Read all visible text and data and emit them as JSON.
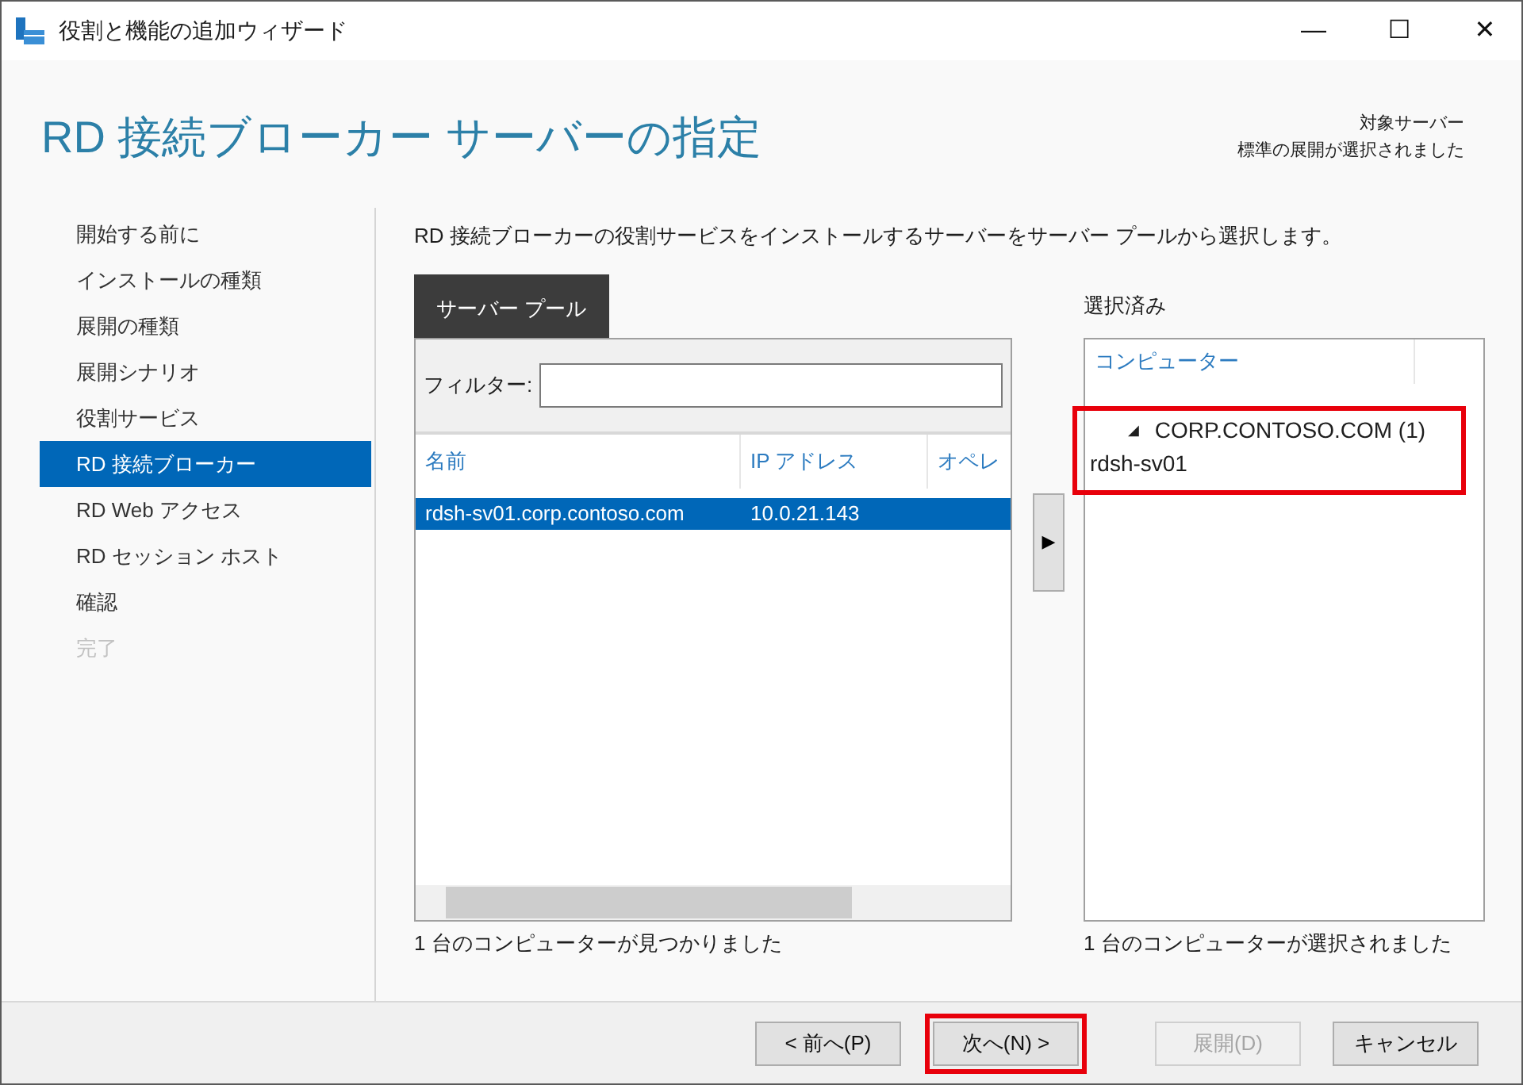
{
  "window": {
    "title": "役割と機能の追加ウィザード",
    "controls": [
      "—",
      "☐",
      "✕"
    ]
  },
  "header": {
    "title": "RD 接続ブローカー サーバーの指定",
    "target_label": "対象サーバー",
    "target_value": "標準の展開が選択されました"
  },
  "steps": [
    {
      "label": "開始する前に",
      "selected": false,
      "disabled": false
    },
    {
      "label": "インストールの種類",
      "selected": false,
      "disabled": false
    },
    {
      "label": "展開の種類",
      "selected": false,
      "disabled": false
    },
    {
      "label": "展開シナリオ",
      "selected": false,
      "disabled": false
    },
    {
      "label": "役割サービス",
      "selected": false,
      "disabled": false
    },
    {
      "label": "RD 接続ブローカー",
      "selected": true,
      "disabled": false
    },
    {
      "label": "RD Web アクセス",
      "selected": false,
      "disabled": false
    },
    {
      "label": "RD セッション ホスト",
      "selected": false,
      "disabled": false
    },
    {
      "label": "確認",
      "selected": false,
      "disabled": false
    },
    {
      "label": "完了",
      "selected": false,
      "disabled": true
    }
  ],
  "instruction": "RD 接続ブローカーの役割サービスをインストールするサーバーをサーバー プールから選択します。",
  "pool": {
    "tab": {
      "label": "サーバー プール",
      "selected": true
    },
    "filter_label": "フィルター:",
    "columns": [
      "名前",
      "IP アドレス",
      "オペレ"
    ],
    "rows": [
      {
        "cells": [
          "rdsh-sv01.corp.contoso.com",
          "10.0.21.143"
        ],
        "selected": true
      }
    ],
    "status": "1 台のコンピューターが見つかりました"
  },
  "add_button": "▶",
  "selected_list": {
    "label": "選択済み",
    "column": "コンピューター",
    "groups": [
      {
        "label": "CORP.CONTOSO.COM (1)",
        "expander": "◢",
        "expanded": true,
        "highlighted": true,
        "children": [
          {
            "label": "rdsh-sv01"
          }
        ]
      }
    ],
    "status": "1 台のコンピューターが選択されました"
  },
  "buttons": [
    {
      "label": "< 前へ(P)",
      "disabled": false,
      "highlighted": false
    },
    {
      "label": "次へ(N) >",
      "disabled": false,
      "highlighted": true
    },
    {
      "label": "展開(D)",
      "disabled": true,
      "highlighted": false
    },
    {
      "label": "キャンセル",
      "disabled": false,
      "highlighted": false
    }
  ]
}
